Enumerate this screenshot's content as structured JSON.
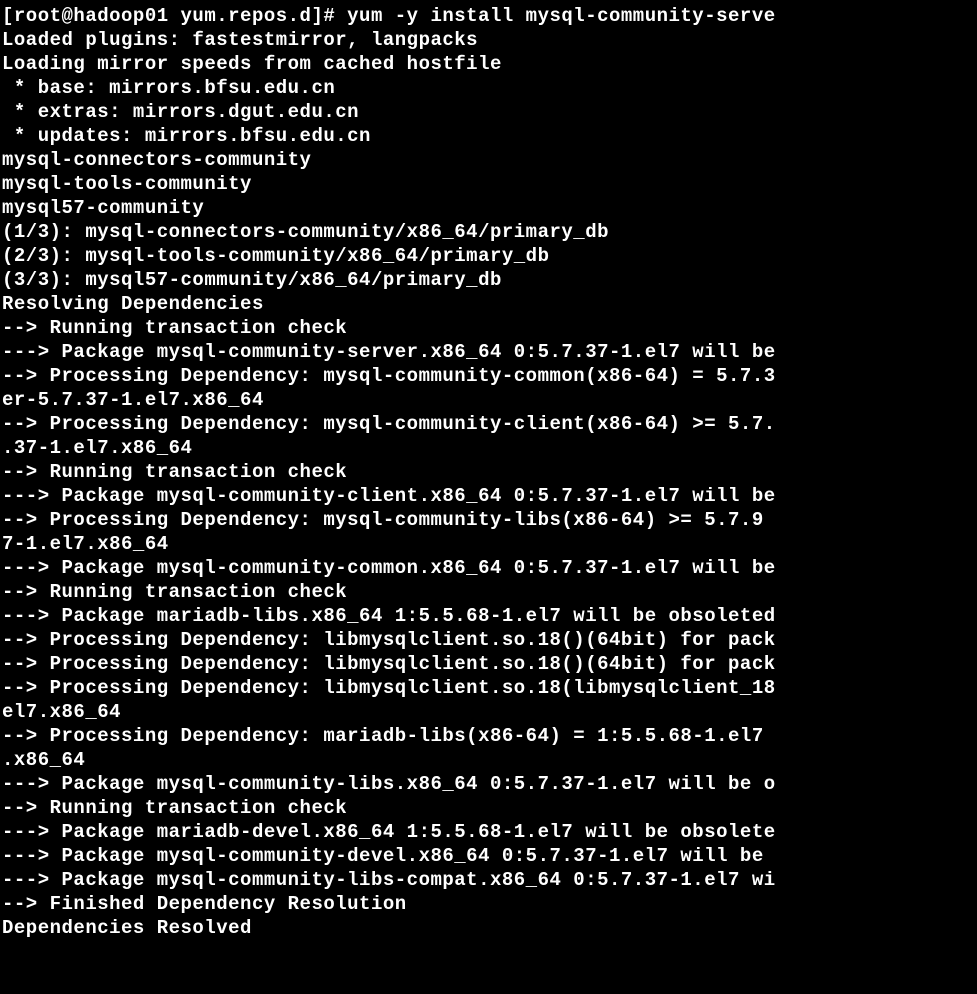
{
  "terminal": {
    "lines": [
      "[root@hadoop01 yum.repos.d]# yum -y install mysql-community-serve",
      "Loaded plugins: fastestmirror, langpacks",
      "Loading mirror speeds from cached hostfile",
      " * base: mirrors.bfsu.edu.cn",
      " * extras: mirrors.dgut.edu.cn",
      " * updates: mirrors.bfsu.edu.cn",
      "mysql-connectors-community",
      "mysql-tools-community",
      "mysql57-community",
      "(1/3): mysql-connectors-community/x86_64/primary_db",
      "(2/3): mysql-tools-community/x86_64/primary_db",
      "(3/3): mysql57-community/x86_64/primary_db",
      "Resolving Dependencies",
      "--> Running transaction check",
      "---> Package mysql-community-server.x86_64 0:5.7.37-1.el7 will be",
      "--> Processing Dependency: mysql-community-common(x86-64) = 5.7.3",
      "er-5.7.37-1.el7.x86_64",
      "--> Processing Dependency: mysql-community-client(x86-64) >= 5.7.",
      ".37-1.el7.x86_64",
      "--> Running transaction check",
      "---> Package mysql-community-client.x86_64 0:5.7.37-1.el7 will be",
      "--> Processing Dependency: mysql-community-libs(x86-64) >= 5.7.9 ",
      "7-1.el7.x86_64",
      "---> Package mysql-community-common.x86_64 0:5.7.37-1.el7 will be",
      "--> Running transaction check",
      "---> Package mariadb-libs.x86_64 1:5.5.68-1.el7 will be obsoleted",
      "--> Processing Dependency: libmysqlclient.so.18()(64bit) for pack",
      "--> Processing Dependency: libmysqlclient.so.18()(64bit) for pack",
      "--> Processing Dependency: libmysqlclient.so.18(libmysqlclient_18",
      "el7.x86_64",
      "--> Processing Dependency: mariadb-libs(x86-64) = 1:5.5.68-1.el7 ",
      ".x86_64",
      "---> Package mysql-community-libs.x86_64 0:5.7.37-1.el7 will be o",
      "--> Running transaction check",
      "---> Package mariadb-devel.x86_64 1:5.5.68-1.el7 will be obsolete",
      "---> Package mysql-community-devel.x86_64 0:5.7.37-1.el7 will be ",
      "---> Package mysql-community-libs-compat.x86_64 0:5.7.37-1.el7 wi",
      "--> Finished Dependency Resolution",
      "",
      "Dependencies Resolved"
    ]
  }
}
